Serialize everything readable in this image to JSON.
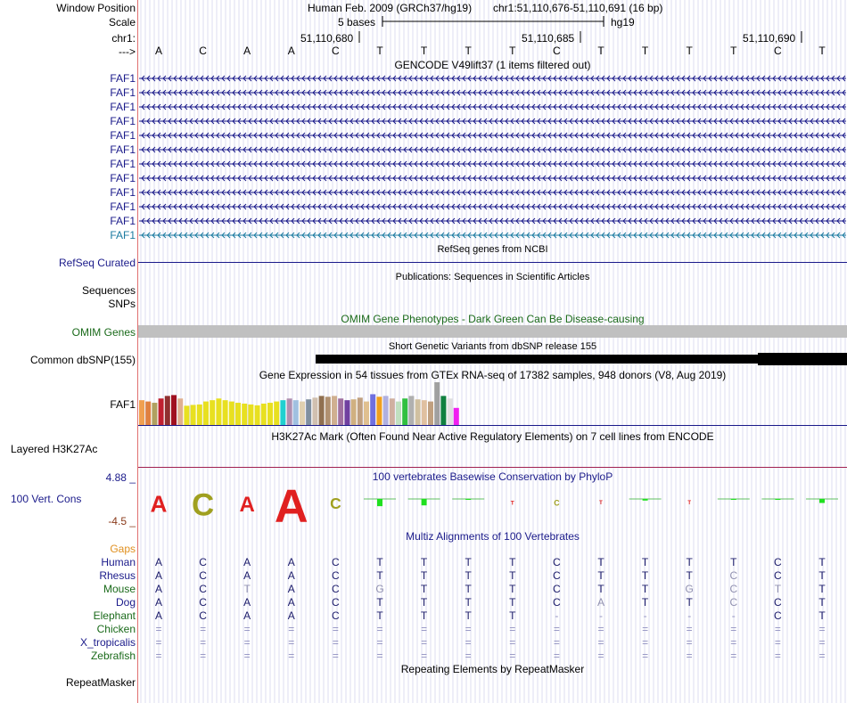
{
  "header": {
    "window_position_label": "Window Position",
    "scale_label": "Scale",
    "chrom_label": "chr1:",
    "arrow_label": "--->",
    "assembly": "Human Feb. 2009 (GRCh37/hg19)",
    "position": "chr1:51,110,676-51,110,691 (16 bp)",
    "scale_text": "5 bases",
    "scale_db": "hg19",
    "ruler_ticks": [
      "51,110,680",
      "51,110,685",
      "51,110,690"
    ]
  },
  "bases": [
    "A",
    "C",
    "A",
    "A",
    "C",
    "T",
    "T",
    "T",
    "T",
    "C",
    "T",
    "T",
    "T",
    "T",
    "C",
    "T"
  ],
  "gencode": {
    "title": "GENCODE V49lift37 (1 items filtered out)",
    "genes": [
      "FAF1",
      "FAF1",
      "FAF1",
      "FAF1",
      "FAF1",
      "FAF1",
      "FAF1",
      "FAF1",
      "FAF1",
      "FAF1",
      "FAF1",
      "FAF1"
    ],
    "last_color": "#1a7aa0",
    "color": "#1a1a8a"
  },
  "refseq": {
    "title": "RefSeq genes from NCBI",
    "label": "RefSeq Curated"
  },
  "publications": {
    "title": "Publications: Sequences in Scientific Articles",
    "labels": [
      "Sequences",
      "SNPs"
    ]
  },
  "omim": {
    "title": "OMIM Gene Phenotypes - Dark Green Can Be Disease-causing",
    "label": "OMIM Genes"
  },
  "dbsnp": {
    "title": "Short Genetic Variants from dbSNP release 155",
    "label": "Common dbSNP(155)"
  },
  "gtex": {
    "title": "Gene Expression in 54 tissues from GTEx RNA-seq of 17382 samples, 948 donors (V8, Aug 2019)",
    "label": "FAF1",
    "bars": [
      {
        "v": 0.58,
        "c": "#f0a050"
      },
      {
        "v": 0.55,
        "c": "#e08040"
      },
      {
        "v": 0.52,
        "c": "#b0a060"
      },
      {
        "v": 0.62,
        "c": "#c02030"
      },
      {
        "v": 0.68,
        "c": "#903030"
      },
      {
        "v": 0.7,
        "c": "#a01020"
      },
      {
        "v": 0.62,
        "c": "#e0b090"
      },
      {
        "v": 0.45,
        "c": "#e8e020"
      },
      {
        "v": 0.47,
        "c": "#e8e020"
      },
      {
        "v": 0.48,
        "c": "#e8e020"
      },
      {
        "v": 0.55,
        "c": "#e8e020"
      },
      {
        "v": 0.58,
        "c": "#e8e020"
      },
      {
        "v": 0.62,
        "c": "#e8e020"
      },
      {
        "v": 0.58,
        "c": "#e8e020"
      },
      {
        "v": 0.55,
        "c": "#e8e020"
      },
      {
        "v": 0.52,
        "c": "#e8e020"
      },
      {
        "v": 0.5,
        "c": "#e8e020"
      },
      {
        "v": 0.48,
        "c": "#e8e020"
      },
      {
        "v": 0.46,
        "c": "#e8e020"
      },
      {
        "v": 0.5,
        "c": "#e8e020"
      },
      {
        "v": 0.52,
        "c": "#e8e020"
      },
      {
        "v": 0.55,
        "c": "#e8e020"
      },
      {
        "v": 0.58,
        "c": "#20d0d0"
      },
      {
        "v": 0.62,
        "c": "#b090b0"
      },
      {
        "v": 0.58,
        "c": "#a0c0e0"
      },
      {
        "v": 0.55,
        "c": "#e0d0b0"
      },
      {
        "v": 0.6,
        "c": "#8090a0"
      },
      {
        "v": 0.64,
        "c": "#d0c0b0"
      },
      {
        "v": 0.68,
        "c": "#907050"
      },
      {
        "v": 0.66,
        "c": "#b09070"
      },
      {
        "v": 0.68,
        "c": "#d0b090"
      },
      {
        "v": 0.62,
        "c": "#a070a0"
      },
      {
        "v": 0.58,
        "c": "#7040a0"
      },
      {
        "v": 0.6,
        "c": "#d0b080"
      },
      {
        "v": 0.64,
        "c": "#c0a080"
      },
      {
        "v": 0.55,
        "c": "#e0c090"
      },
      {
        "v": 0.72,
        "c": "#7070e0"
      },
      {
        "v": 0.66,
        "c": "#f0a020"
      },
      {
        "v": 0.68,
        "c": "#b0b0e0"
      },
      {
        "v": 0.62,
        "c": "#d0b0a0"
      },
      {
        "v": 0.55,
        "c": "#c0e0c0"
      },
      {
        "v": 0.62,
        "c": "#30c040"
      },
      {
        "v": 0.68,
        "c": "#b0b0b0"
      },
      {
        "v": 0.6,
        "c": "#d0c0a0"
      },
      {
        "v": 0.58,
        "c": "#e0c0a0"
      },
      {
        "v": 0.55,
        "c": "#c0a080"
      },
      {
        "v": 1.0,
        "c": "#a0a0a0"
      },
      {
        "v": 0.68,
        "c": "#108040"
      },
      {
        "v": 0.62,
        "c": "#e0e0e0"
      },
      {
        "v": 0.4,
        "c": "#f020f0"
      }
    ]
  },
  "h3k27ac": {
    "title": "H3K27Ac Mark (Often Found Near Active Regulatory Elements) on 7 cell lines from ENCODE",
    "label": "Layered H3K27Ac"
  },
  "phylop": {
    "title": "100 vertebrates Basewise Conservation by PhyloP",
    "label": "100 Vert. Cons",
    "max": "4.88 _",
    "min": "-4.5 _",
    "scores": [
      -1.2,
      -1.6,
      -1.1,
      -2.4,
      -0.8,
      0.9,
      0.8,
      0.1,
      -0.3,
      -0.4,
      -0.2,
      0.2,
      -0.2,
      0.1,
      0.1,
      0.5
    ],
    "ymin": -4.5,
    "ymax": 4.88
  },
  "multiz": {
    "title": "Multiz Alignments of 100 Vertebrates",
    "gaps_label": "Gaps",
    "species": [
      {
        "name": "Human",
        "color": "#1a1a8a",
        "seq": [
          "A",
          "C",
          "A",
          "A",
          "C",
          "T",
          "T",
          "T",
          "T",
          "C",
          "T",
          "T",
          "T",
          "T",
          "C",
          "T"
        ]
      },
      {
        "name": "Rhesus",
        "color": "#1a1a8a",
        "seq": [
          "A",
          "C",
          "A",
          "A",
          "C",
          "T",
          "T",
          "T",
          "T",
          "C",
          "T",
          "T",
          "T",
          "C",
          "C",
          "T"
        ]
      },
      {
        "name": "Mouse",
        "color": "#1a6a1a",
        "seq": [
          "A",
          "C",
          "T",
          "A",
          "C",
          "G",
          "T",
          "T",
          "T",
          "C",
          "T",
          "T",
          "G",
          "C",
          "T",
          "T"
        ]
      },
      {
        "name": "Dog",
        "color": "#1a1a8a",
        "seq": [
          "A",
          "C",
          "A",
          "A",
          "C",
          "T",
          "T",
          "T",
          "T",
          "C",
          "A",
          "T",
          "T",
          "C",
          "C",
          "T"
        ]
      },
      {
        "name": "Elephant",
        "color": "#1a6a1a",
        "seq": [
          "A",
          "C",
          "A",
          "A",
          "C",
          "T",
          "T",
          "T",
          "T",
          "-",
          "-",
          "-",
          "-",
          "-",
          "C",
          "T"
        ]
      },
      {
        "name": "Chicken",
        "color": "#1a6a1a",
        "seq": [
          "=",
          "=",
          "=",
          "=",
          "=",
          "=",
          "=",
          "=",
          "=",
          "=",
          "=",
          "=",
          "=",
          "=",
          "=",
          "="
        ]
      },
      {
        "name": "X_tropicalis",
        "color": "#1a1a8a",
        "seq": [
          "=",
          "=",
          "=",
          "=",
          "=",
          "=",
          "=",
          "=",
          "=",
          "=",
          "=",
          "=",
          "=",
          "=",
          "=",
          "="
        ]
      },
      {
        "name": "Zebrafish",
        "color": "#1a6a1a",
        "seq": [
          "=",
          "=",
          "=",
          "=",
          "=",
          "=",
          "=",
          "=",
          "=",
          "=",
          "=",
          "=",
          "=",
          "=",
          "=",
          "="
        ]
      }
    ]
  },
  "repeatmasker": {
    "title": "Repeating Elements by RepeatMasker",
    "label": "RepeatMasker"
  }
}
